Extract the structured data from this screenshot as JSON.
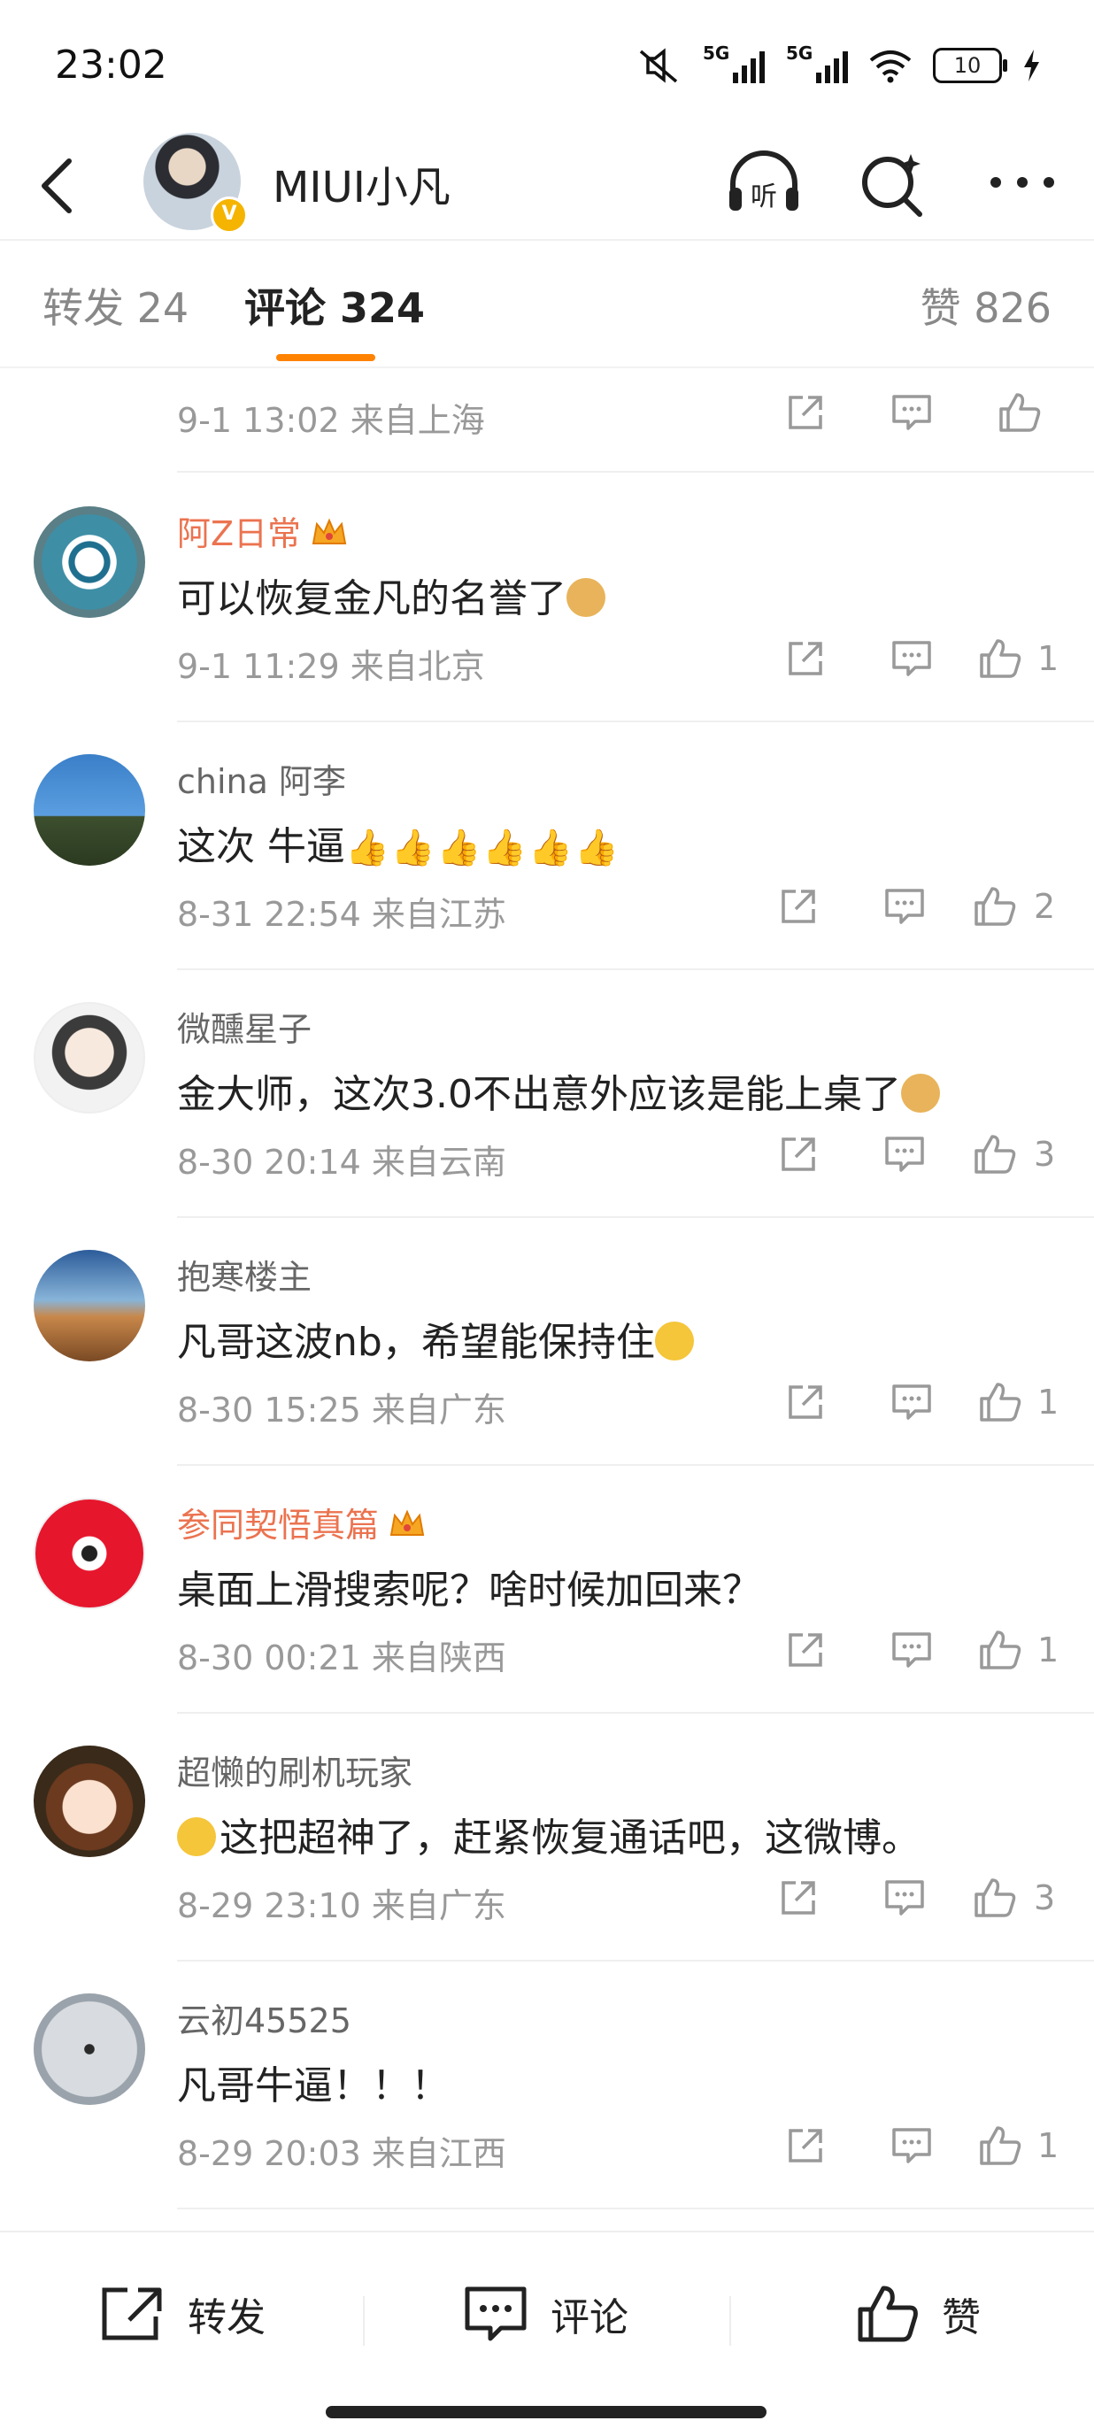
{
  "status_bar": {
    "time": "23:02",
    "network_label_1": "5G",
    "network_label_2": "5G",
    "battery": "10",
    "icons": [
      "mute-icon",
      "signal-icon",
      "signal-icon",
      "wifi-icon",
      "battery-icon",
      "charging-icon"
    ]
  },
  "header": {
    "title": "MIUI小凡",
    "verified_badge": "V",
    "icons": [
      "back-icon",
      "listen-icon",
      "search-icon",
      "more-icon"
    ],
    "listen_label": "听"
  },
  "tabs": {
    "repost": "转发 24",
    "comments": "评论 324",
    "likes": "赞 826",
    "accent_color": "#ff8200"
  },
  "top_partial": {
    "meta": "9-1 13:02  来自上海"
  },
  "comments": [
    {
      "name": "阿Z日常",
      "vip": true,
      "text": "可以恢复金凡的名誉了",
      "emoji": "doge",
      "meta": "9-1 11:29  来自北京",
      "likes": "1"
    },
    {
      "name": "china 阿李",
      "vip": false,
      "text": "这次 牛逼",
      "emoji": "thumbs-x6",
      "meta": "8-31 22:54  来自江苏",
      "likes": "2"
    },
    {
      "name": "微醺星子",
      "vip": false,
      "text": "金大师，这次3.0不出意外应该是能上桌了",
      "emoji": "doge",
      "meta": "8-30 20:14  来自云南",
      "likes": "3"
    },
    {
      "name": "抱寒楼主",
      "vip": false,
      "text": "凡哥这波nb，希望能保持住",
      "emoji": "laugh-cry",
      "meta": "8-30 15:25  来自广东",
      "likes": "1"
    },
    {
      "name": "参同契悟真篇",
      "vip": true,
      "text": "桌面上滑搜索呢？啥时候加回来？",
      "emoji": "",
      "meta": "8-30 00:21  来自陕西",
      "likes": "1"
    },
    {
      "name": "超懒的刷机玩家",
      "vip": false,
      "text": "这把超神了，赶紧恢复通话吧，这微博。",
      "emoji": "kiss-leading",
      "meta": "8-29 23:10  来自广东",
      "likes": "3"
    },
    {
      "name": "云初45525",
      "vip": false,
      "text": "凡哥牛逼！！！",
      "emoji": "",
      "meta": "8-29 20:03  来自江西",
      "likes": "1"
    }
  ],
  "bottom_bar": {
    "repost": "转发",
    "comment": "评论",
    "like": "赞"
  }
}
